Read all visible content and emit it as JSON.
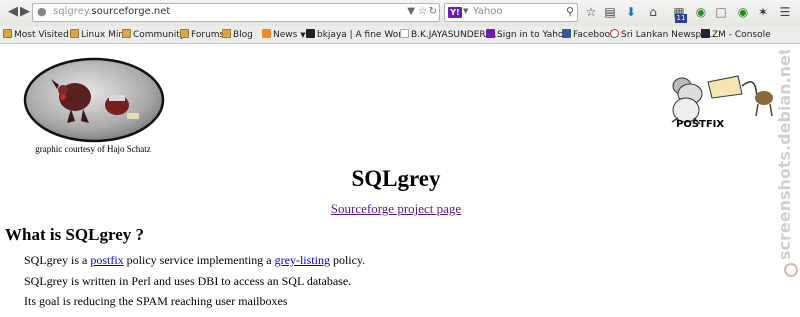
{
  "browser": {
    "url_host": "sqlgrey.",
    "url_domain": "sourceforge.net",
    "search_placeholder": "Yahoo",
    "search_engine_logo": "Y!",
    "notification_count": "11"
  },
  "bookmarks": [
    {
      "label": "Most Visited",
      "icon": "folder-icon"
    },
    {
      "label": "Linux Mint",
      "icon": "folder-icon"
    },
    {
      "label": "Community",
      "icon": "folder-icon"
    },
    {
      "label": "Forums",
      "icon": "folder-icon"
    },
    {
      "label": "Blog",
      "icon": "folder-icon"
    },
    {
      "label": "News",
      "icon": "rss-icon"
    },
    {
      "label": "bkjaya | A fine Wor...",
      "icon": "site-icon"
    },
    {
      "label": "B.K.JAYASUNDERA'...",
      "icon": "page-icon"
    },
    {
      "label": "Sign in to Yahoo",
      "icon": "yahoo-icon"
    },
    {
      "label": "Facebook",
      "icon": "facebook-icon"
    },
    {
      "label": "Sri Lankan Newspa...",
      "icon": "site-icon"
    },
    {
      "label": "ZM - Console",
      "icon": "zm-icon"
    }
  ],
  "page": {
    "credit": "graphic courtesy of Hajo Schatz",
    "postfix_label": "POSTFIX",
    "title": "SQLgrey",
    "sourceforge_link": "Sourceforge project page",
    "heading": "What is SQLgrey ?",
    "p1_prefix": "SQLgrey is a ",
    "p1_link1": "postfix",
    "p1_middle": " policy service implementing a ",
    "p1_link2": "grey-listing",
    "p1_suffix": " policy.",
    "p2": "SQLgrey is written in Perl and uses DBI to access an SQL database.",
    "p3": "Its goal is reducing the SPAM reaching user mailboxes"
  },
  "watermark": {
    "text": "screenshots.debian.net"
  },
  "colors": {
    "link_visited": "#551a8b",
    "link": "#0000ee",
    "watermark": "#d0d0d0"
  }
}
